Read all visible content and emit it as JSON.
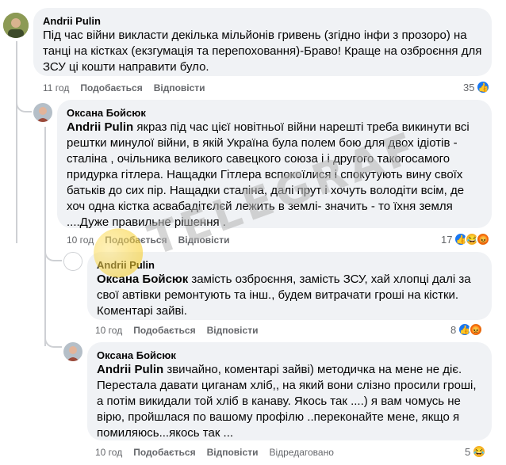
{
  "comments": [
    {
      "author": "Andrii Pulin",
      "text": "Під час війни викласти декілька мільйонів гривень (згідно інфи з прозоро) на танці на кістках (екзгумація та перепоховання)-Браво! Краще на озброєння для ЗСУ ці кошти направити було.",
      "time": "11 год",
      "like": "Подобається",
      "reply": "Відповісти",
      "react_count": "35",
      "avatar_color": "#7d8a4a"
    },
    {
      "author": "Оксана Бойсюк",
      "mention": "Andrii Pulin",
      "text": " якраз під час цієї новітньої війни нарешті треба викинути всі рештки минулої війни, в якій Україна була полем бою для двох ідіотів - сталіна , очільника великого савецкого союза і і другого такогосамого придурка гітлера. Нащадки Гітлера вспокоїлися і спокутують вину своїх батьків до сих пір. Нащадки сталіна, далі прут і хочуть володіти всім, де хоч одна кістка асвабадітєлєй лежить в землі- значить - то їхня земля ....Дуже правильне рішення .",
      "time": "10 год",
      "like": "Подобається",
      "reply": "Відповісти",
      "react_count": "17",
      "avatar_color": "#c98f7a"
    },
    {
      "author": "Andrii Pulin",
      "mention": "Оксана Бойсюк",
      "text": " замість озброєння, замість ЗСУ, хай хлопці далі за свої автівки ремонтують та інш., будем витрачати гроші на кістки. Коментарі зайві.",
      "time": "10 год",
      "like": "Подобається",
      "reply": "Відповісти",
      "react_count": "8",
      "avatar_color": "#ffffff"
    },
    {
      "author": "Оксана Бойсюк",
      "mention": "Andrii Pulin",
      "text": " звичайно, коментарі зайві) методичка на мене не діє. Перестала давати циганам хліб,, на який вони слізно просили гроші, а потім викидали той хліб в канаву. Якось так ....) я вам чомусь не вірю, пройшлася по вашому профілю ..переконайте мене, якщо я помиляюсь...якось так ...",
      "time": "10 год",
      "like": "Подобається",
      "reply": "Відповісти",
      "edited": "Відредаговано",
      "react_count": "5",
      "avatar_color": "#c98f7a"
    }
  ],
  "watermark": "TELEGRAF",
  "colors": {
    "bubble": "#f0f2f5",
    "meta": "#65676b",
    "like": "#1877f2"
  }
}
